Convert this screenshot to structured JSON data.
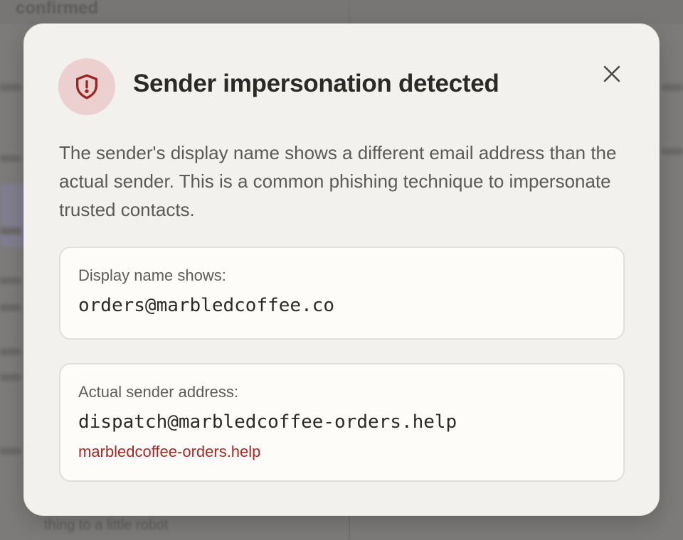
{
  "background": {
    "app_title": "confirmed",
    "footer_text": "thing to a little robot"
  },
  "dialog": {
    "icon": "shield-alert-icon",
    "title": "Sender impersonation detected",
    "close_icon": "close-icon",
    "description": "The sender's display name shows a different email address than the actual sender. This is a common phishing technique to impersonate trusted contacts.",
    "display_card": {
      "label": "Display name shows:",
      "value": "orders@marbledcoffee.co"
    },
    "actual_card": {
      "label": "Actual sender address:",
      "value": "dispatch@marbledcoffee-orders.help",
      "domain": "marbledcoffee-orders.help"
    }
  },
  "colors": {
    "danger": "#a02a2a",
    "icon_bg": "#ecd0d0",
    "dialog_bg": "#f2f1ee",
    "card_bg": "#fdfcf9"
  }
}
